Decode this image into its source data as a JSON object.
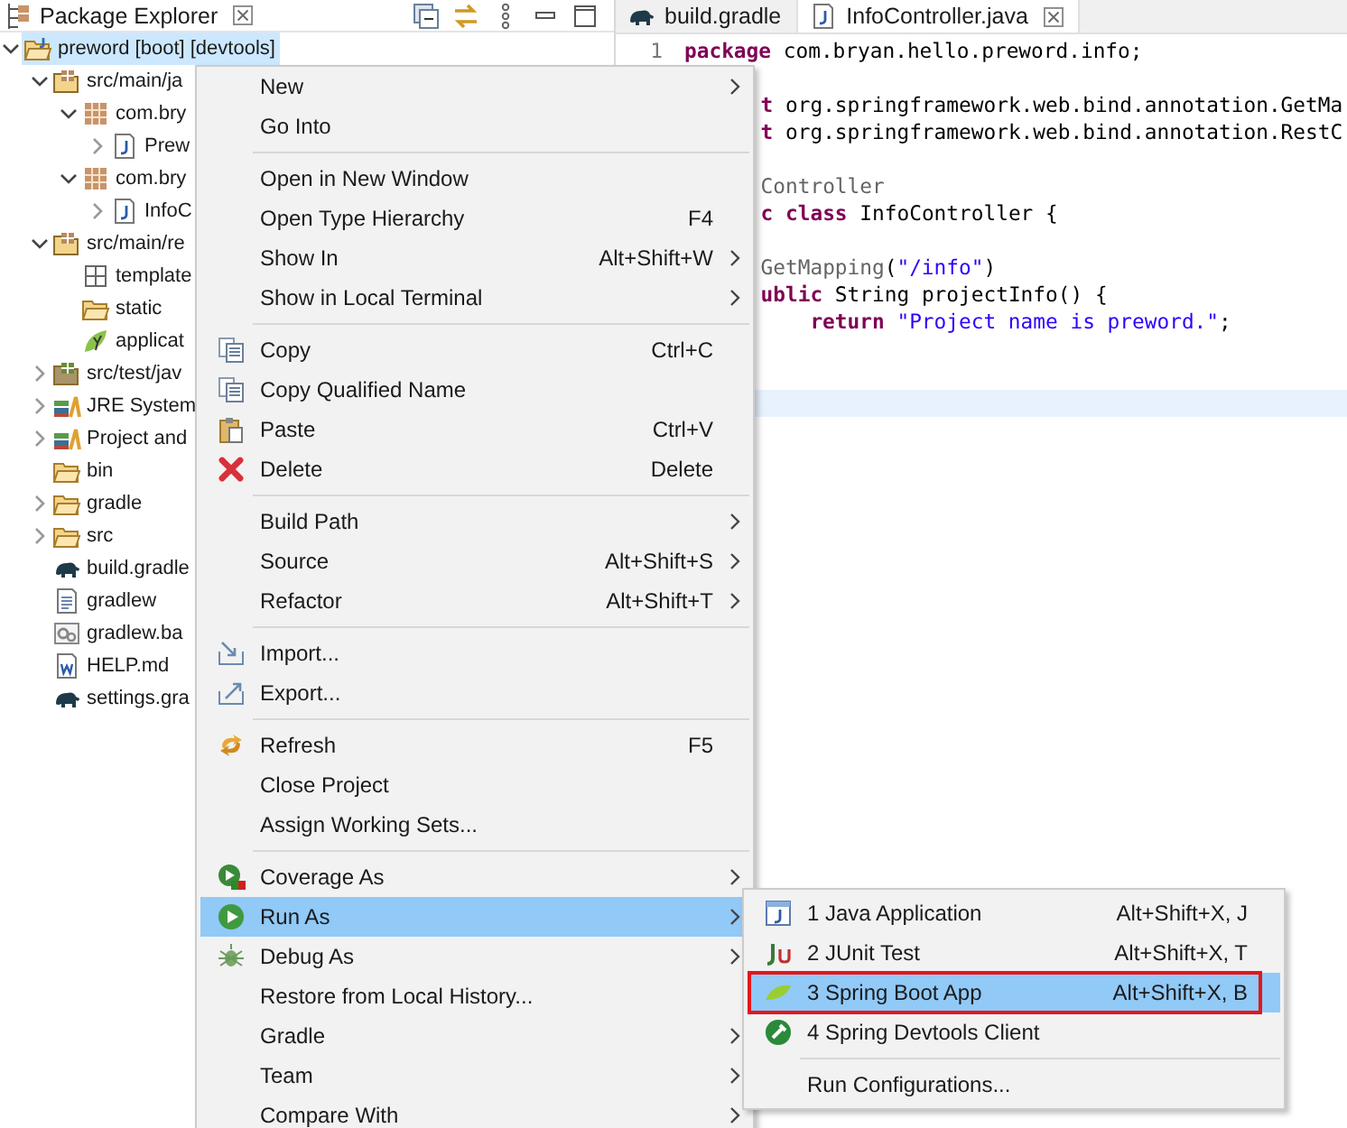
{
  "explorer": {
    "title": "Package Explorer"
  },
  "tree": [
    {
      "label": "preword [boot] [devtools]",
      "kind": "project",
      "expanded": true,
      "selected": true,
      "children": [
        {
          "label": "src/main/ja",
          "kind": "source-folder",
          "expanded": true,
          "selected": false,
          "children": [
            {
              "label": "com.bry",
              "kind": "package",
              "expanded": true,
              "selected": false,
              "children": [
                {
                  "label": "Prew",
                  "kind": "java-file",
                  "expanded": false,
                  "selected": false
                }
              ]
            },
            {
              "label": "com.bry",
              "kind": "package",
              "expanded": true,
              "selected": false,
              "children": [
                {
                  "label": "InfoC",
                  "kind": "java-file",
                  "expanded": false,
                  "selected": false
                }
              ]
            }
          ]
        },
        {
          "label": "src/main/re",
          "kind": "source-folder",
          "expanded": true,
          "selected": false,
          "children": [
            {
              "label": "template",
              "kind": "empty-package",
              "selected": false
            },
            {
              "label": "static",
              "kind": "folder",
              "selected": false
            },
            {
              "label": "applicat",
              "kind": "spring-file",
              "selected": false
            }
          ]
        },
        {
          "label": "src/test/jav",
          "kind": "test-folder",
          "expanded": false,
          "selected": false
        },
        {
          "label": "JRE System",
          "kind": "library",
          "expanded": false,
          "selected": false
        },
        {
          "label": "Project and",
          "kind": "library",
          "expanded": false,
          "selected": false
        },
        {
          "label": "bin",
          "kind": "folder",
          "selected": false
        },
        {
          "label": "gradle",
          "kind": "folder",
          "expanded": false,
          "selected": false
        },
        {
          "label": "src",
          "kind": "folder",
          "expanded": false,
          "selected": false
        },
        {
          "label": "build.gradle",
          "kind": "gradle-file",
          "selected": false
        },
        {
          "label": "gradlew",
          "kind": "text-file",
          "selected": false
        },
        {
          "label": "gradlew.ba",
          "kind": "script-file",
          "selected": false
        },
        {
          "label": "HELP.md",
          "kind": "doc-file",
          "selected": false
        },
        {
          "label": "settings.gra",
          "kind": "gradle-file",
          "selected": false
        }
      ]
    }
  ],
  "editor_tabs": [
    {
      "label": "build.gradle",
      "kind": "gradle",
      "selected": false
    },
    {
      "label": "InfoController.java",
      "kind": "java",
      "selected": true
    }
  ],
  "code": {
    "line_number": "1",
    "lines": [
      {
        "kind": "code",
        "covered_start": false,
        "tokens": [
          {
            "text": "package",
            "kind": "keyword"
          },
          {
            "text": " com.bryan.hello.preword.info;",
            "kind": "plain"
          }
        ]
      },
      {
        "kind": "blank"
      },
      {
        "kind": "code",
        "covered_start": true,
        "tokens": [
          {
            "text": "t",
            "kind": "keyword"
          },
          {
            "text": " org.springframework.web.bind.annotation.GetMa",
            "kind": "plain"
          }
        ]
      },
      {
        "kind": "code",
        "covered_start": true,
        "tokens": [
          {
            "text": "t",
            "kind": "keyword"
          },
          {
            "text": " org.springframework.web.bind.annotation.RestC",
            "kind": "plain"
          }
        ]
      },
      {
        "kind": "blank"
      },
      {
        "kind": "code",
        "covered_start": true,
        "tokens": [
          {
            "text": "Controller",
            "kind": "annotation"
          }
        ]
      },
      {
        "kind": "code",
        "covered_start": true,
        "tokens": [
          {
            "text": "c class",
            "kind": "keyword"
          },
          {
            "text": " InfoController {",
            "kind": "plain"
          }
        ]
      },
      {
        "kind": "blank"
      },
      {
        "kind": "code",
        "covered_start": true,
        "tokens": [
          {
            "text": "GetMapping",
            "kind": "annotation"
          },
          {
            "text": "(",
            "kind": "plain"
          },
          {
            "text": "\"/info\"",
            "kind": "string"
          },
          {
            "text": ")",
            "kind": "plain"
          }
        ]
      },
      {
        "kind": "code",
        "covered_start": true,
        "tokens": [
          {
            "text": "ublic",
            "kind": "keyword"
          },
          {
            "text": " String projectInfo() {",
            "kind": "plain"
          }
        ]
      },
      {
        "kind": "code",
        "covered_start": true,
        "indented": true,
        "tokens": [
          {
            "text": "return",
            "kind": "keyword"
          },
          {
            "text": " \"Project name is preword.\"",
            "kind": "string"
          },
          {
            "text": ";",
            "kind": "plain"
          }
        ]
      },
      {
        "kind": "blank"
      },
      {
        "kind": "blank"
      },
      {
        "kind": "blank",
        "current": true
      }
    ]
  },
  "context_menu": {
    "groups": [
      [
        {
          "label": "New",
          "submenu": true,
          "selected": false
        },
        {
          "label": "Go Into",
          "selected": false
        }
      ],
      [
        {
          "label": "Open in New Window",
          "selected": false
        },
        {
          "label": "Open Type Hierarchy",
          "shortcut": "F4",
          "selected": false
        },
        {
          "label": "Show In",
          "shortcut": "Alt+Shift+W",
          "submenu": true,
          "selected": false
        },
        {
          "label": "Show in Local Terminal",
          "submenu": true,
          "selected": false
        }
      ],
      [
        {
          "label": "Copy",
          "shortcut": "Ctrl+C",
          "selected": false
        },
        {
          "label": "Copy Qualified Name",
          "selected": false
        },
        {
          "label": "Paste",
          "shortcut": "Ctrl+V",
          "selected": false
        },
        {
          "label": "Delete",
          "shortcut": "Delete",
          "selected": false
        }
      ],
      [
        {
          "label": "Build Path",
          "submenu": true,
          "selected": false
        },
        {
          "label": "Source",
          "shortcut": "Alt+Shift+S",
          "submenu": true,
          "selected": false
        },
        {
          "label": "Refactor",
          "shortcut": "Alt+Shift+T",
          "submenu": true,
          "selected": false
        }
      ],
      [
        {
          "label": "Import...",
          "selected": false
        },
        {
          "label": "Export...",
          "selected": false
        }
      ],
      [
        {
          "label": "Refresh",
          "shortcut": "F5",
          "selected": false
        },
        {
          "label": "Close Project",
          "selected": false
        },
        {
          "label": "Assign Working Sets...",
          "selected": false
        }
      ],
      [
        {
          "label": "Coverage As",
          "submenu": true,
          "selected": false
        },
        {
          "label": "Run As",
          "submenu": true,
          "selected": true
        },
        {
          "label": "Debug As",
          "submenu": true,
          "selected": false
        },
        {
          "label": "Restore from Local History...",
          "selected": false
        },
        {
          "label": "Gradle",
          "submenu": true,
          "selected": false
        },
        {
          "label": "Team",
          "submenu": true,
          "selected": false
        },
        {
          "label": "Compare With",
          "submenu": true,
          "selected": false
        }
      ]
    ]
  },
  "run_as_menu": {
    "groups": [
      [
        {
          "label": "1 Java Application",
          "shortcut": "Alt+Shift+X, J",
          "selected": false,
          "annotated": false
        },
        {
          "label": "2 JUnit Test",
          "shortcut": "Alt+Shift+X, T",
          "selected": false,
          "annotated": false
        },
        {
          "label": "3 Spring Boot App",
          "shortcut": "Alt+Shift+X, B",
          "selected": true,
          "annotated": true
        },
        {
          "label": "4 Spring Devtools Client",
          "selected": false,
          "annotated": false
        }
      ],
      [
        {
          "label": "Run Configurations...",
          "selected": false,
          "annotated": false
        }
      ]
    ]
  }
}
